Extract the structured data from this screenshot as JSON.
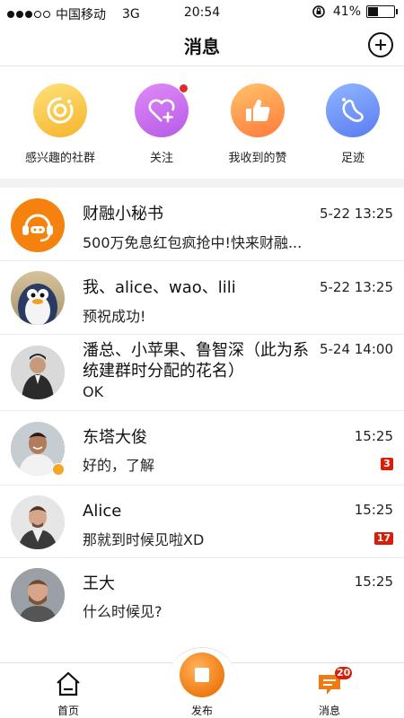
{
  "status_bar": {
    "carrier": "中国移动",
    "network": "3G",
    "time": "20:54",
    "battery": "41%",
    "battery_level": 0.41
  },
  "nav": {
    "title": "消息",
    "add_icon": "plus-circle-icon"
  },
  "shortcuts": [
    {
      "label": "感兴趣的社群",
      "icon": "community-icon",
      "color_from": "#fde17a",
      "color_to": "#f6b42c"
    },
    {
      "label": "关注",
      "icon": "heart-plus-icon",
      "color_from": "#e08af6",
      "color_to": "#b65be8",
      "has_dot": true
    },
    {
      "label": "我收到的赞",
      "icon": "thumbs-up-icon",
      "color_from": "#ffc36a",
      "color_to": "#ff7a3a"
    },
    {
      "label": "足迹",
      "icon": "footprint-icon",
      "color_from": "#8fb6ff",
      "color_to": "#5a7cf2"
    }
  ],
  "chats": [
    {
      "name": "财融小秘书",
      "time": "5-22  13:25",
      "message": "500万免息红包疯抢中!快来财融...",
      "avatar": "customer-service-avatar"
    },
    {
      "name": "我、alice、wao、lili",
      "time": "5-22  13:25",
      "message": "预祝成功!",
      "avatar": "penguin-avatar"
    },
    {
      "name": "潘总、小苹果、鲁智深（此为系统建群时分配的花名）",
      "time": "5-24 14:00",
      "message": "OK",
      "avatar": "man-suit-avatar"
    },
    {
      "name": "东塔大俊",
      "time": "15:25",
      "message": "好的，了解",
      "badge": "3",
      "verified": true,
      "avatar": "smiling-man-avatar"
    },
    {
      "name": "Alice",
      "time": "15:25",
      "message": "那就到时候见啦XD",
      "badge": "17",
      "avatar": "man-jacket-avatar"
    },
    {
      "name": "王大",
      "time": "15:25",
      "message": "什么时候见?",
      "avatar": "bearded-man-avatar"
    }
  ],
  "tabbar": {
    "home": {
      "label": "首页",
      "icon": "home-icon"
    },
    "publish": {
      "label": "发布",
      "icon": "publish-icon"
    },
    "messages": {
      "label": "消息",
      "icon": "message-icon",
      "badge": "20",
      "active_color": "#f07a12"
    }
  }
}
